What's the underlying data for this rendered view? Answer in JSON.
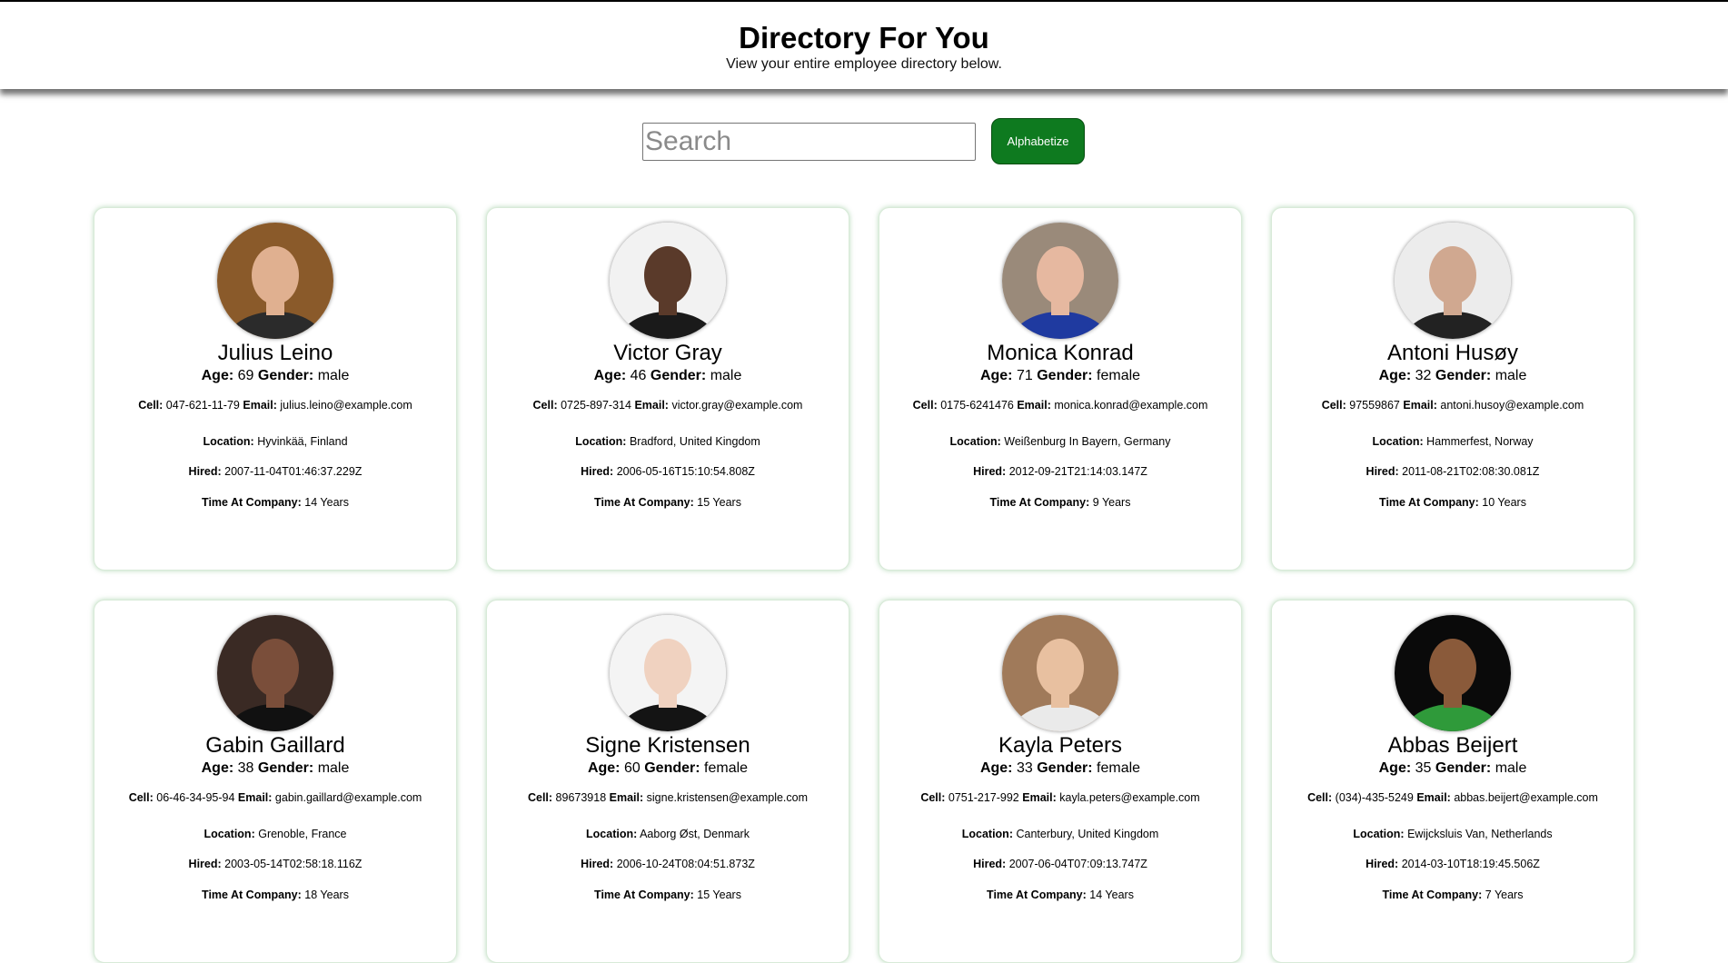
{
  "header": {
    "title": "Directory For You",
    "subtitle": "View your entire employee directory below."
  },
  "search": {
    "placeholder": "Search",
    "value": ""
  },
  "toolbar": {
    "alphabetize_label": "Alphabetize"
  },
  "labels": {
    "age": "Age:",
    "gender": "Gender:",
    "cell": "Cell:",
    "email": "Email:",
    "location": "Location:",
    "hired": "Hired:",
    "time": "Time At Company:"
  },
  "employees": [
    {
      "name": "Julius Leino",
      "age": "69",
      "gender": "male",
      "cell": "047-621-11-79",
      "email": "julius.leino@example.com",
      "location": "Hyvinkää, Finland",
      "hired": "2007-11-04T01:46:37.229Z",
      "time": "14 Years",
      "avatar_colors": [
        "#8a5a2a",
        "#e0b090",
        "#2b2b2b"
      ]
    },
    {
      "name": "Victor Gray",
      "age": "46",
      "gender": "male",
      "cell": "0725-897-314",
      "email": "victor.gray@example.com",
      "location": "Bradford, United Kingdom",
      "hired": "2006-05-16T15:10:54.808Z",
      "time": "15 Years",
      "avatar_colors": [
        "#f2f2f2",
        "#5a3a2a",
        "#1a1a1a"
      ]
    },
    {
      "name": "Monica Konrad",
      "age": "71",
      "gender": "female",
      "cell": "0175-6241476",
      "email": "monica.konrad@example.com",
      "location": "Weißenburg In Bayern, Germany",
      "hired": "2012-09-21T21:14:03.147Z",
      "time": "9 Years",
      "avatar_colors": [
        "#9a8a7a",
        "#e6b8a0",
        "#1f3aa0"
      ]
    },
    {
      "name": "Antoni Husøy",
      "age": "32",
      "gender": "male",
      "cell": "97559867",
      "email": "antoni.husoy@example.com",
      "location": "Hammerfest, Norway",
      "hired": "2011-08-21T02:08:30.081Z",
      "time": "10 Years",
      "avatar_colors": [
        "#ececec",
        "#d0a890",
        "#222222"
      ]
    },
    {
      "name": "Gabin Gaillard",
      "age": "38",
      "gender": "male",
      "cell": "06-46-34-95-94",
      "email": "gabin.gaillard@example.com",
      "location": "Grenoble, France",
      "hired": "2003-05-14T02:58:18.116Z",
      "time": "18 Years",
      "avatar_colors": [
        "#3a2a24",
        "#7a4e3a",
        "#111111"
      ]
    },
    {
      "name": "Signe Kristensen",
      "age": "60",
      "gender": "female",
      "cell": "89673918",
      "email": "signe.kristensen@example.com",
      "location": "Aaborg Øst, Denmark",
      "hired": "2006-10-24T08:04:51.873Z",
      "time": "15 Years",
      "avatar_colors": [
        "#f4f4f4",
        "#f0d2c0",
        "#141414"
      ]
    },
    {
      "name": "Kayla Peters",
      "age": "33",
      "gender": "female",
      "cell": "0751-217-992",
      "email": "kayla.peters@example.com",
      "location": "Canterbury, United Kingdom",
      "hired": "2007-06-04T07:09:13.747Z",
      "time": "14 Years",
      "avatar_colors": [
        "#a07a5a",
        "#e8c0a0",
        "#eaeaea"
      ]
    },
    {
      "name": "Abbas Beijert",
      "age": "35",
      "gender": "male",
      "cell": "(034)-435-5249",
      "email": "abbas.beijert@example.com",
      "location": "Ewijcksluis Van, Netherlands",
      "hired": "2014-03-10T18:19:45.506Z",
      "time": "7 Years",
      "avatar_colors": [
        "#0a0a0a",
        "#8a5a3a",
        "#2f9a3a"
      ]
    }
  ]
}
